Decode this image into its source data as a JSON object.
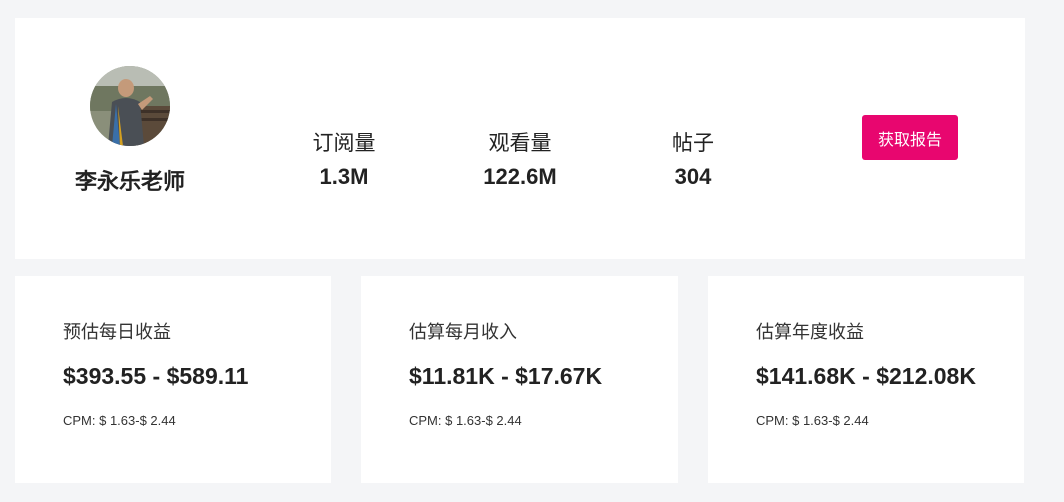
{
  "profile": {
    "name": "李永乐老师",
    "stats": [
      {
        "label": "订阅量",
        "value": "1.3M"
      },
      {
        "label": "观看量",
        "value": "122.6M"
      },
      {
        "label": "帖子",
        "value": "304"
      }
    ],
    "report_button_label": "获取报告",
    "accent_color": "#e8066f"
  },
  "earnings": [
    {
      "title": "预估每日收益",
      "range": "$393.55 - $589.11",
      "cpm": "CPM: $ 1.63-$ 2.44"
    },
    {
      "title": "估算每月收入",
      "range": "$11.81K - $17.67K",
      "cpm": "CPM: $ 1.63-$ 2.44"
    },
    {
      "title": "估算年度收益",
      "range": "$141.68K - $212.08K",
      "cpm": "CPM: $ 1.63-$ 2.44"
    }
  ]
}
